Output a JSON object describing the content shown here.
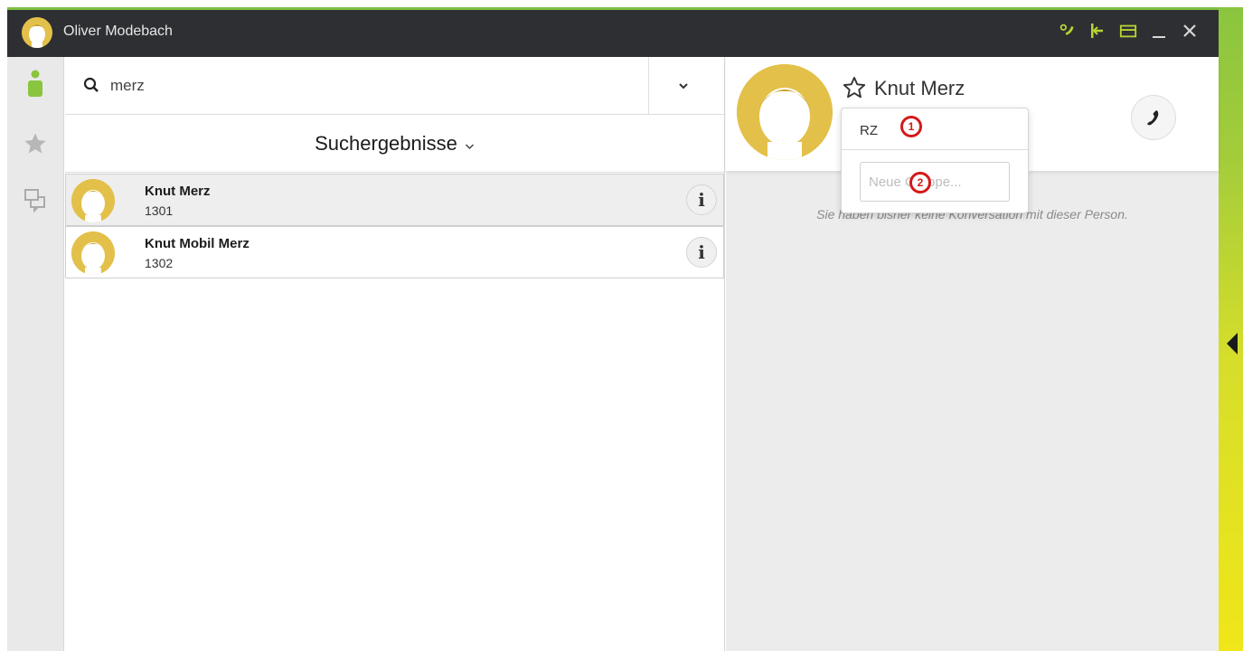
{
  "titlebar": {
    "user_name": "Oliver Modebach",
    "icons": [
      "settings-icon",
      "dock-icon",
      "restore-window-icon",
      "minimize-icon",
      "close-icon"
    ]
  },
  "rail": {
    "items": [
      "contacts-icon",
      "favorites-star-icon",
      "conversations-icon"
    ]
  },
  "search": {
    "value": "merz",
    "placeholder": ""
  },
  "results": {
    "title": "Suchergebnisse",
    "items": [
      {
        "name": "Knut Merz",
        "number": "1301"
      },
      {
        "name": "Knut Mobil Merz",
        "number": "1302"
      }
    ]
  },
  "contact": {
    "name": "Knut Merz",
    "empty_message": "Sie haben bisher keine Konversation mit dieser Person."
  },
  "popup": {
    "group_item": "RZ",
    "new_group_placeholder": "Neue Gruppe..."
  },
  "markers": [
    "1",
    "2"
  ],
  "colors": {
    "accent_green": "#7dc142",
    "avatar_yellow": "#e3c04a",
    "titlebar": "#2e2f33",
    "marker_red": "#d41919"
  }
}
